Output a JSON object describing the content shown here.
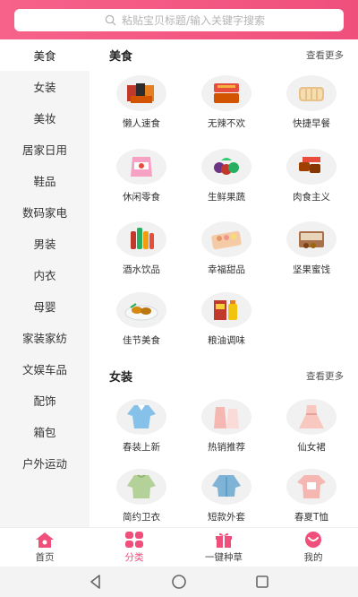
{
  "search": {
    "placeholder": "粘贴宝贝标题/输入关键字搜索"
  },
  "sidebar": {
    "items": [
      {
        "label": "美食",
        "active": true
      },
      {
        "label": "女装"
      },
      {
        "label": "美妆"
      },
      {
        "label": "居家日用"
      },
      {
        "label": "鞋品"
      },
      {
        "label": "数码家电"
      },
      {
        "label": "男装"
      },
      {
        "label": "内衣"
      },
      {
        "label": "母婴"
      },
      {
        "label": "家装家纺"
      },
      {
        "label": "文娱车品"
      },
      {
        "label": "配饰"
      },
      {
        "label": "箱包"
      },
      {
        "label": "户外运动"
      }
    ]
  },
  "sections": [
    {
      "title": "美食",
      "more": "查看更多",
      "items": [
        {
          "label": "懒人速食",
          "icon": "instant-food-icon"
        },
        {
          "label": "无辣不欢",
          "icon": "spicy-food-icon"
        },
        {
          "label": "快捷早餐",
          "icon": "bread-icon"
        },
        {
          "label": "休闲零食",
          "icon": "snack-bag-icon"
        },
        {
          "label": "生鲜果蔬",
          "icon": "fruit-icon"
        },
        {
          "label": "肉食主义",
          "icon": "meat-icon"
        },
        {
          "label": "酒水饮品",
          "icon": "drinks-icon"
        },
        {
          "label": "幸福甜品",
          "icon": "dessert-icon"
        },
        {
          "label": "坚果蜜饯",
          "icon": "nuts-icon"
        },
        {
          "label": "佳节美食",
          "icon": "festival-food-icon"
        },
        {
          "label": "粮油调味",
          "icon": "grain-oil-icon"
        }
      ]
    },
    {
      "title": "女装",
      "more": "查看更多",
      "items": [
        {
          "label": "春装上新",
          "icon": "blouse-icon"
        },
        {
          "label": "热销推荐",
          "icon": "pink-set-icon"
        },
        {
          "label": "仙女裙",
          "icon": "dress-icon"
        },
        {
          "label": "简约卫衣",
          "icon": "sweatshirt-icon"
        },
        {
          "label": "短款外套",
          "icon": "denim-jacket-icon"
        },
        {
          "label": "春夏T恤",
          "icon": "tshirt-icon"
        }
      ]
    }
  ],
  "tabbar": {
    "items": [
      {
        "label": "首页",
        "icon": "home-icon"
      },
      {
        "label": "分类",
        "icon": "category-icon",
        "active": true
      },
      {
        "label": "一键种草",
        "icon": "gift-icon"
      },
      {
        "label": "我的",
        "icon": "profile-icon"
      }
    ]
  },
  "colors": {
    "accent": "#f04f7c",
    "sidebar_bg": "#f5f5f5",
    "icon_bg": "#f1f1f1"
  }
}
